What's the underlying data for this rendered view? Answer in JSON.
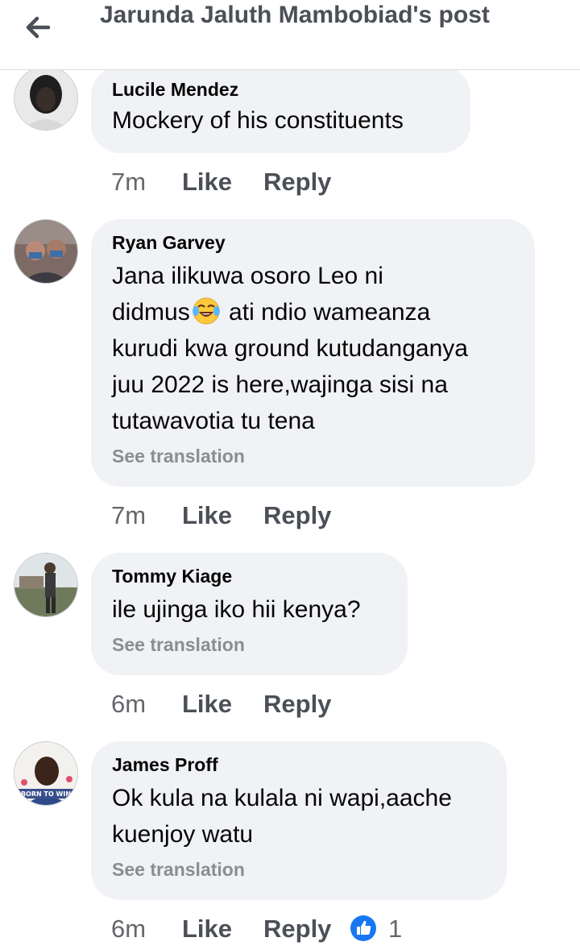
{
  "header": {
    "title": "Jarunda Jaluth Mambobiad's post",
    "back_icon": "arrow-left-icon"
  },
  "comments": [
    {
      "author": "Lucile Mendez",
      "text": "Mockery of his constituents",
      "time": "7m",
      "like_label": "Like",
      "reply_label": "Reply"
    },
    {
      "author": "Ryan Garvey",
      "text_before_emoji": "Jana ilikuwa osoro Leo ni\ndidmus",
      "emoji": "face-with-tears-of-joy-icon",
      "text_after_emoji": " ati ndio wameanza\nkurudi kwa ground kutudanganya\njuu 2022 is here,wajinga sisi na\ntutawavotia tu tena",
      "see_translation": "See translation",
      "time": "7m",
      "like_label": "Like",
      "reply_label": "Reply"
    },
    {
      "author": "Tommy Kiage",
      "text": "ile ujinga iko hii kenya?",
      "see_translation": "See translation",
      "time": "6m",
      "like_label": "Like",
      "reply_label": "Reply"
    },
    {
      "author": "James Proff",
      "text": "Ok kula na kulala ni wapi,aache\nkuenjoy watu",
      "see_translation": "See translation",
      "time": "6m",
      "like_label": "Like",
      "reply_label": "Reply",
      "reaction_icon": "thumbs-up-icon",
      "reaction_count": "1",
      "avatar_caption": "BORN TO WIN"
    }
  ],
  "colors": {
    "bubble_bg": "#f0f2f5",
    "text": "#050505",
    "secondary": "#65676b",
    "muted": "#8a8d91",
    "like_blue": "#1877f2"
  }
}
